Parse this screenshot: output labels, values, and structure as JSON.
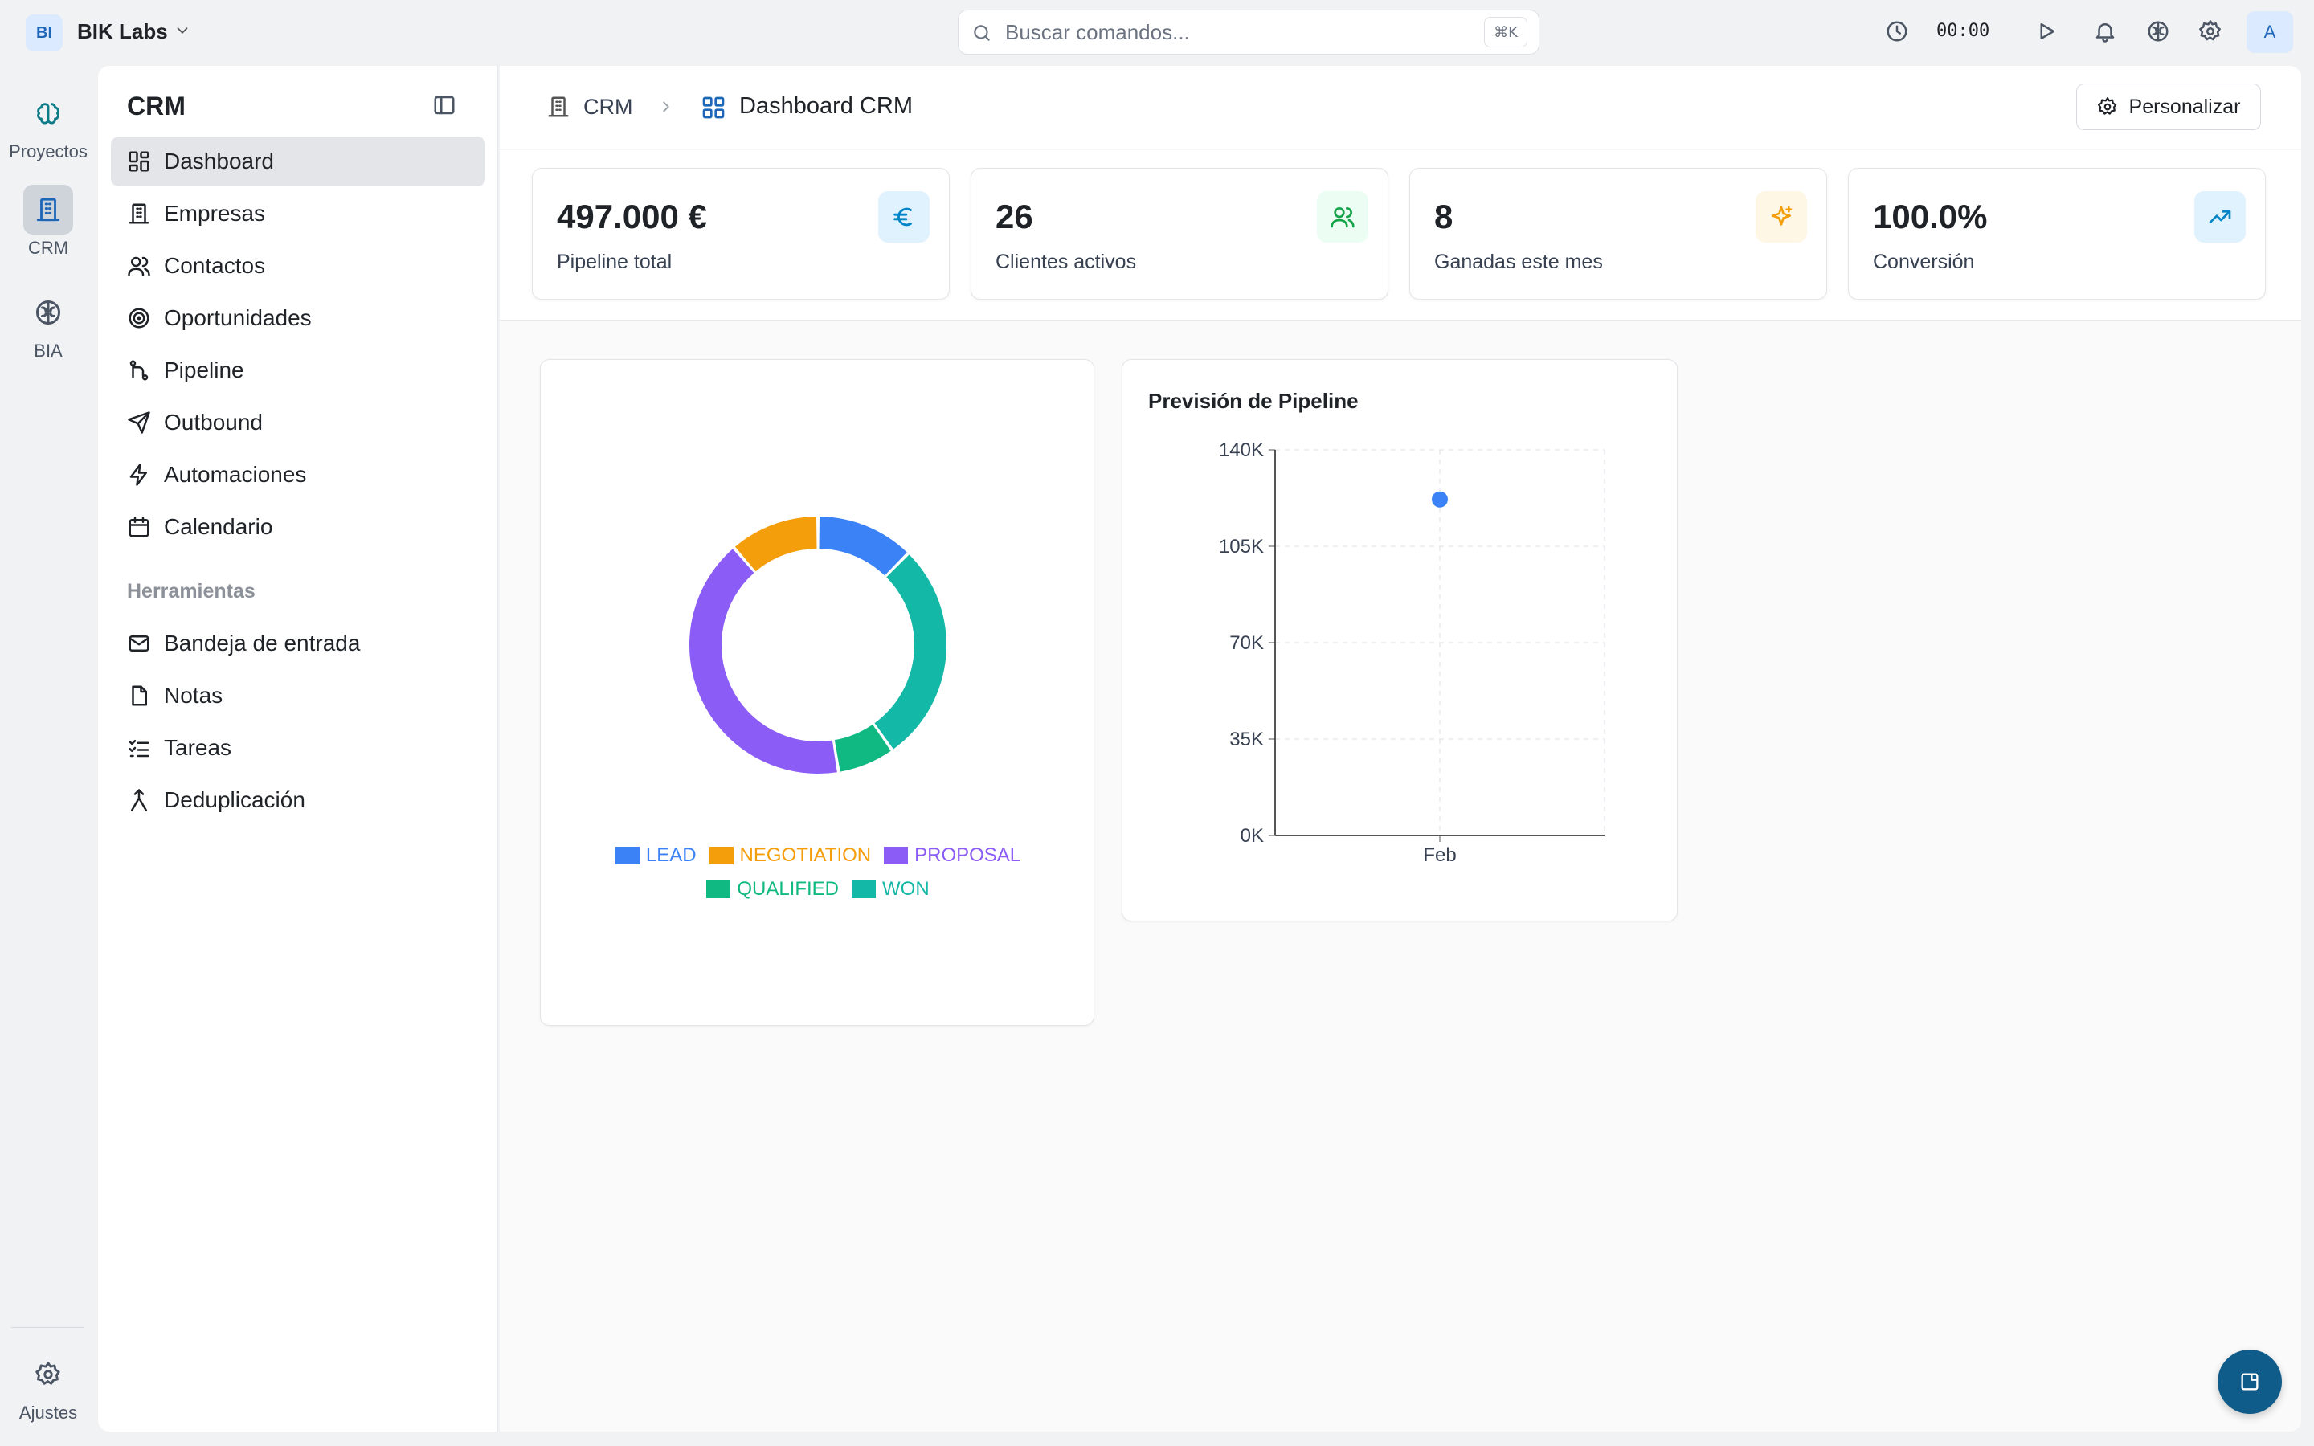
{
  "topbar": {
    "org_initials": "BI",
    "org_name": "BIK Labs",
    "search_placeholder": "Buscar comandos...",
    "search_shortcut": "⌘K",
    "timer": "00:00",
    "avatar_initial": "A"
  },
  "rail": {
    "items": [
      {
        "label": "Proyectos",
        "icon": "projects-icon"
      },
      {
        "label": "CRM",
        "icon": "building-icon"
      },
      {
        "label": "BIA",
        "icon": "brain-icon"
      }
    ],
    "settings_label": "Ajustes"
  },
  "sidebar": {
    "title": "CRM",
    "items": [
      {
        "label": "Dashboard",
        "icon": "dashboard-icon"
      },
      {
        "label": "Empresas",
        "icon": "building-icon"
      },
      {
        "label": "Contactos",
        "icon": "users-icon"
      },
      {
        "label": "Oportunidades",
        "icon": "target-icon"
      },
      {
        "label": "Pipeline",
        "icon": "pipeline-icon"
      },
      {
        "label": "Outbound",
        "icon": "send-icon"
      },
      {
        "label": "Automaciones",
        "icon": "zap-icon"
      },
      {
        "label": "Calendario",
        "icon": "calendar-icon"
      }
    ],
    "section_label": "Herramientas",
    "tools": [
      {
        "label": "Bandeja de entrada",
        "icon": "mail-icon"
      },
      {
        "label": "Notas",
        "icon": "file-icon"
      },
      {
        "label": "Tareas",
        "icon": "list-checks-icon"
      },
      {
        "label": "Deduplicación",
        "icon": "merge-icon"
      }
    ]
  },
  "header": {
    "breadcrumb_root": "CRM",
    "breadcrumb_current": "Dashboard CRM",
    "customize_label": "Personalizar"
  },
  "stats": [
    {
      "value": "497.000 €",
      "label": "Pipeline total",
      "icon": "euro-icon",
      "color": "#0ea5e9",
      "bg": "#e0f2fe"
    },
    {
      "value": "26",
      "label": "Clientes activos",
      "icon": "users-icon",
      "color": "#16a34a",
      "bg": "#ecfdf3"
    },
    {
      "value": "8",
      "label": "Ganadas este mes",
      "icon": "sparkles-icon",
      "color": "#f59e0b",
      "bg": "#fff7e6"
    },
    {
      "value": "100.0%",
      "label": "Conversión",
      "icon": "trending-up-icon",
      "color": "#0284c7",
      "bg": "#e0f2fe"
    }
  ],
  "chart_data": [
    {
      "type": "pie",
      "labels": [
        "LEAD",
        "QUALIFIED",
        "WON",
        "PROPOSAL",
        "NEGOTIATION"
      ],
      "values": [
        12,
        27,
        7,
        40,
        11
      ],
      "colors": [
        "#3b82f6",
        "#14b8a6",
        "#10b981",
        "#8b5cf6",
        "#f59e0b"
      ],
      "legend": [
        {
          "name": "LEAD",
          "color": "#3b82f6"
        },
        {
          "name": "NEGOTIATION",
          "color": "#f59e0b"
        },
        {
          "name": "PROPOSAL",
          "color": "#8b5cf6"
        },
        {
          "name": "QUALIFIED",
          "color": "#10b981"
        },
        {
          "name": "WON",
          "color": "#14b8a6"
        }
      ],
      "legend_placement": "bottom"
    },
    {
      "type": "scatter",
      "title": "Previsión de Pipeline",
      "categories": [
        "Feb"
      ],
      "values": [
        122000
      ],
      "ylim": [
        0,
        140000
      ],
      "yticks": [
        "0K",
        "35K",
        "70K",
        "105K",
        "140K"
      ],
      "grid": true,
      "color": "#3b82f6"
    }
  ]
}
